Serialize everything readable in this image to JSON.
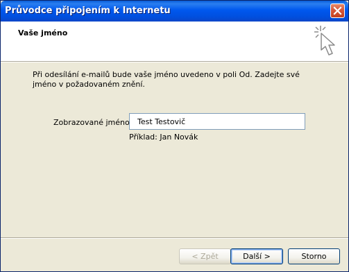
{
  "window": {
    "title": "Průvodce připojením k Internetu",
    "close_icon": "close-icon"
  },
  "header": {
    "title": "Vaše jméno",
    "icon": "wizard-sparkle-cursor-icon"
  },
  "body": {
    "description": "Při odesílání e-mailů bude vaše jméno uvedeno v poli Od. Zadejte své jméno v požadovaném znění.",
    "display_name_label": "Zobrazované jméno:",
    "display_name_value": "Test Testovič",
    "example_text": "Příklad: Jan Novák"
  },
  "buttons": {
    "back_label": "< Zpět",
    "next_label": "Další >",
    "cancel_label": "Storno"
  },
  "colors": {
    "titlebar": "#0054e3",
    "dialog_bg": "#ece9d8",
    "header_bg": "#ffffff",
    "close_button": "#d6573a"
  }
}
